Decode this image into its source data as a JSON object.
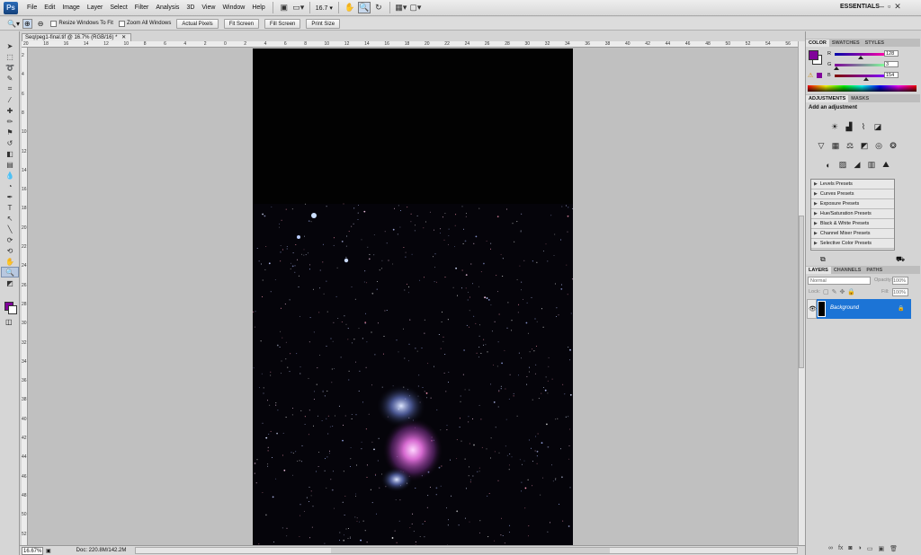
{
  "app": {
    "logo": "Ps",
    "workspace": "ESSENTIALS"
  },
  "menu": [
    "File",
    "Edit",
    "Image",
    "Layer",
    "Select",
    "Filter",
    "Analysis",
    "3D",
    "View",
    "Window",
    "Help"
  ],
  "menubar": {
    "zoom_value": "16.7",
    "icons": [
      "bridge-icon",
      "minibridge-icon",
      "hand-icon",
      "zoom-icon",
      "rotate-icon",
      "arrange-icon",
      "screen-mode-icon"
    ]
  },
  "options": {
    "resize_label": "Resize Windows To Fit",
    "zoom_all_label": "Zoom All Windows",
    "buttons": [
      "Actual Pixels",
      "Fit Screen",
      "Fill Screen",
      "Print Size"
    ]
  },
  "document": {
    "tab_title": "Seq/peg1-final.tif @ 16.7% (RGB/16) *",
    "zoom_field": "16.67%",
    "doc_size": "Doc: 220.8M/142.2M"
  },
  "ruler_top": [
    "20",
    "18",
    "16",
    "14",
    "12",
    "10",
    "8",
    "6",
    "4",
    "2",
    "0",
    "2",
    "4",
    "6",
    "8",
    "10",
    "12",
    "14",
    "16",
    "18",
    "20",
    "22",
    "24",
    "26",
    "28",
    "30",
    "32",
    "34",
    "36",
    "38",
    "40",
    "42",
    "44",
    "46",
    "48",
    "50",
    "52",
    "54",
    "56"
  ],
  "ruler_left": [
    "2",
    "4",
    "6",
    "8",
    "10",
    "12",
    "14",
    "16",
    "18",
    "20",
    "22",
    "24",
    "26",
    "28",
    "30",
    "32",
    "34",
    "36",
    "38",
    "40",
    "42",
    "44",
    "46",
    "48",
    "50",
    "52"
  ],
  "color_panel": {
    "tabs": [
      "COLOR",
      "SWATCHES",
      "STYLES"
    ],
    "channels": [
      {
        "label": "R",
        "value": "128",
        "level": 0.5
      },
      {
        "label": "G",
        "value": "3",
        "level": 0.01
      },
      {
        "label": "B",
        "value": "154",
        "level": 0.6
      }
    ],
    "fg_color": "#80039a",
    "bg_color": "#ffffff"
  },
  "adjustments_panel": {
    "tabs": [
      "ADJUSTMENTS",
      "MASKS"
    ],
    "heading": "Add an adjustment",
    "presets": [
      "Levels Presets",
      "Curves Presets",
      "Exposure Presets",
      "Hue/Saturation Presets",
      "Black & White Presets",
      "Channel Mixer Presets",
      "Selective Color Presets"
    ]
  },
  "layers_panel": {
    "tabs": [
      "LAYERS",
      "CHANNELS",
      "PATHS"
    ],
    "blend_mode": "Normal",
    "opacity_label": "Opacity:",
    "opacity_value": "100%",
    "lock_label": "Lock:",
    "fill_label": "Fill:",
    "fill_value": "100%",
    "layer_name": "Background"
  }
}
